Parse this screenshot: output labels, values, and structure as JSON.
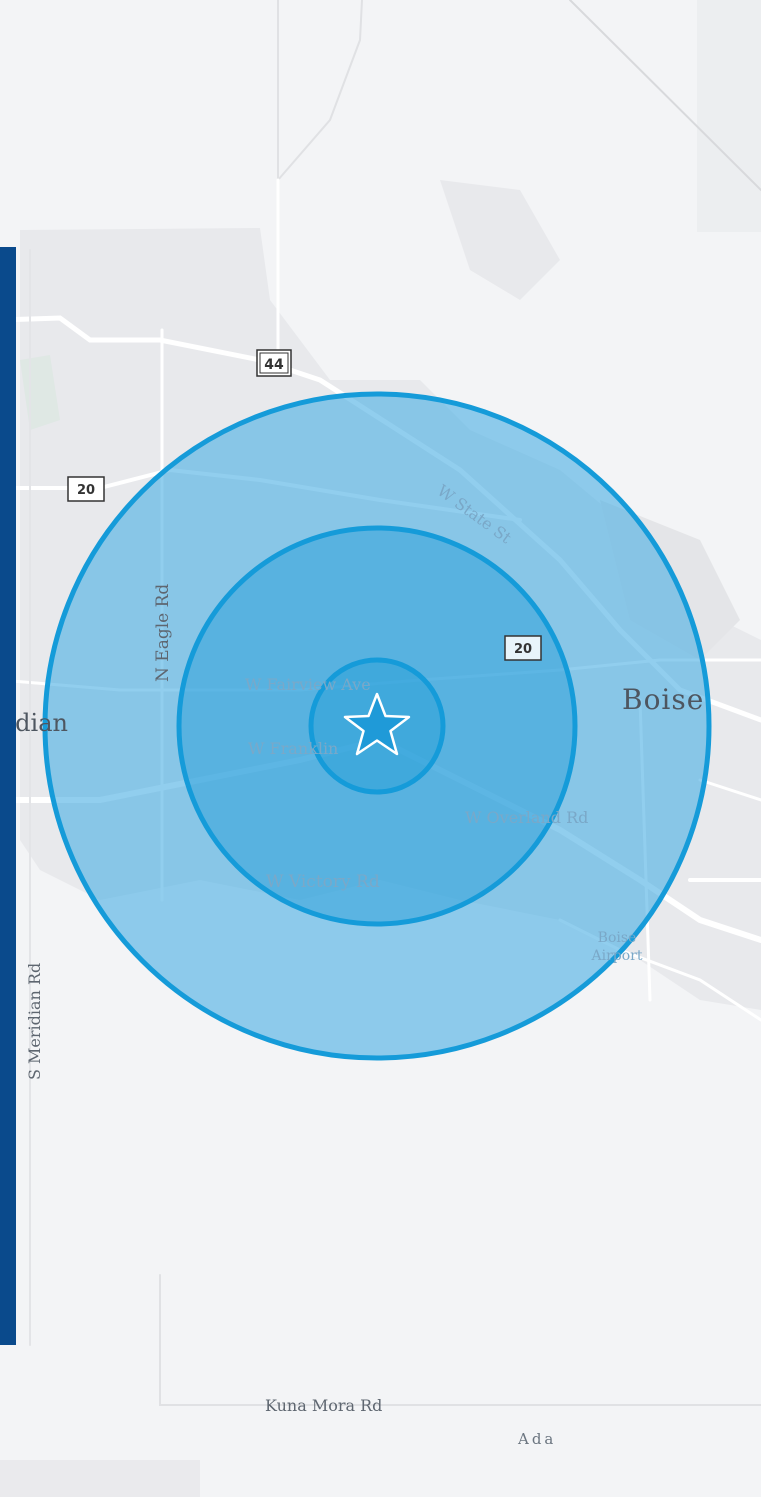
{
  "map": {
    "place_labels": {
      "meridian": "ridian",
      "boise": "Boise",
      "boise_airport_line1": "Boise",
      "boise_airport_line2": "Airport",
      "ada": "Ada"
    },
    "road_labels": {
      "w_state_st": "W State St",
      "n_eagle_rd": "N Eagle Rd",
      "w_fairview_ave": "W Fairview Ave",
      "w_franklin": "W Franklin",
      "w_overland_rd": "W Overland Rd",
      "w_victory_rd": "W Victory Rd",
      "s_meridian_rd": "S Meridian Rd",
      "kuna_mora_rd": "Kuna Mora Rd"
    },
    "highway_shields": {
      "hwy_44": "44",
      "hwy_20_west": "20",
      "hwy_20_center": "20"
    },
    "radius_rings": {
      "count": 3,
      "fill_color": "#4eb0e3",
      "stroke_color": "#159bd9"
    },
    "center_marker": "star-icon",
    "colors": {
      "background": "#f3f4f6",
      "sidebar": "#0a4a8c",
      "roads": "#ffffff",
      "ring_stroke": "#159bd9"
    }
  }
}
